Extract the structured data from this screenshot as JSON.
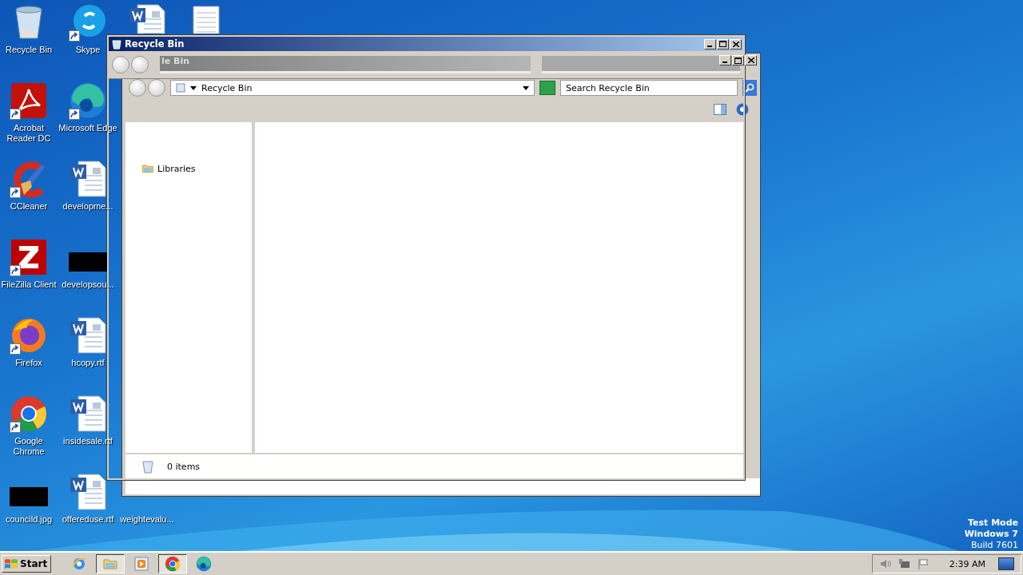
{
  "desktop": {
    "icon_columns": [
      [
        {
          "label": "Recycle Bin",
          "kind": "recycle",
          "shortcut": false
        },
        {
          "label": "Acrobat Reader DC",
          "kind": "acrobat",
          "shortcut": true
        },
        {
          "label": "CCleaner",
          "kind": "ccleaner",
          "shortcut": true
        },
        {
          "label": "FileZilla Client",
          "kind": "filezilla",
          "shortcut": true
        },
        {
          "label": "Firefox",
          "kind": "firefox",
          "shortcut": true
        },
        {
          "label": "Google Chrome",
          "kind": "chrome",
          "shortcut": true
        },
        {
          "label": "councild.jpg",
          "kind": "redacted",
          "shortcut": false
        }
      ],
      [
        {
          "label": "Skype",
          "kind": "skype",
          "shortcut": true
        },
        {
          "label": "Microsoft Edge",
          "kind": "edge",
          "shortcut": true
        },
        {
          "label": "developme...",
          "kind": "word",
          "shortcut": false
        },
        {
          "label": "developsou...",
          "kind": "redacted",
          "shortcut": false
        },
        {
          "label": "hcopy.rtf",
          "kind": "word",
          "shortcut": false
        },
        {
          "label": "insidesale.rtf",
          "kind": "word",
          "shortcut": false
        },
        {
          "label": "offereduse.rtf",
          "kind": "word",
          "shortcut": false
        }
      ],
      [
        {
          "kind": "word",
          "shortcut": false
        },
        {
          "label": "weightevalu...",
          "kind": "none",
          "shortcut": false
        }
      ],
      [
        {
          "kind": "notepad",
          "shortcut": false
        }
      ]
    ]
  },
  "explorer": {
    "title": "Recycle Bin",
    "ghost_title": "le Bin",
    "address": "Recycle Bin",
    "search": {
      "placeholder": "Search Recycle Bin"
    },
    "nav_items": [
      {
        "label": "Libraries"
      }
    ],
    "status": "0 items"
  },
  "os_notice": [
    "Test Mode",
    "Windows 7",
    "Build 7601"
  ],
  "taskbar": {
    "start": "Start",
    "apps": [
      {
        "kind": "ie",
        "selected": false
      },
      {
        "kind": "folder",
        "selected": true
      },
      {
        "kind": "media",
        "selected": false
      },
      {
        "kind": "chrome",
        "selected": true
      },
      {
        "kind": "edge",
        "selected": false
      }
    ],
    "clock": "2:39 AM"
  }
}
